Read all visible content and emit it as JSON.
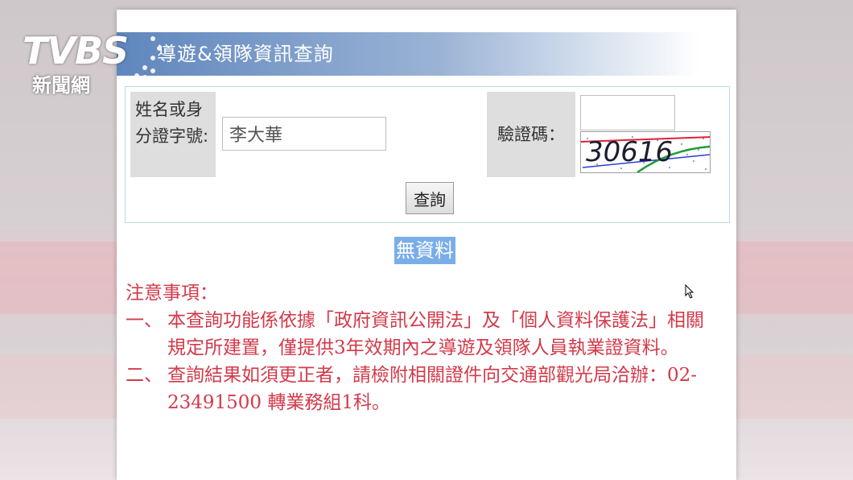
{
  "header": {
    "title": "導遊&領隊資訊查詢"
  },
  "form": {
    "name_label": "姓名或身分證字號:",
    "name_value": "李大華",
    "captcha_label": "驗證碼：",
    "captcha_code": "30616",
    "submit_label": "查詢"
  },
  "result": {
    "text": "無資料"
  },
  "notes": {
    "heading": "注意事項：",
    "items": [
      {
        "num": "一、",
        "text": "本查詢功能係依據「政府資訊公開法」及「個人資料保護法」相關規定所建置，僅提供3年效期內之導遊及領隊人員執業證資料。"
      },
      {
        "num": "二、",
        "text": "查詢結果如須更正者，請檢附相關證件向交通部觀光局洽辦：02-23491500 轉業務組1科。"
      }
    ]
  },
  "watermark": {
    "brand": "TVBS",
    "sub": "新聞網"
  },
  "colors": {
    "title_bar": "#5f86bd",
    "notes_text": "#d23a4a",
    "result_highlight": "#7aaee8"
  }
}
